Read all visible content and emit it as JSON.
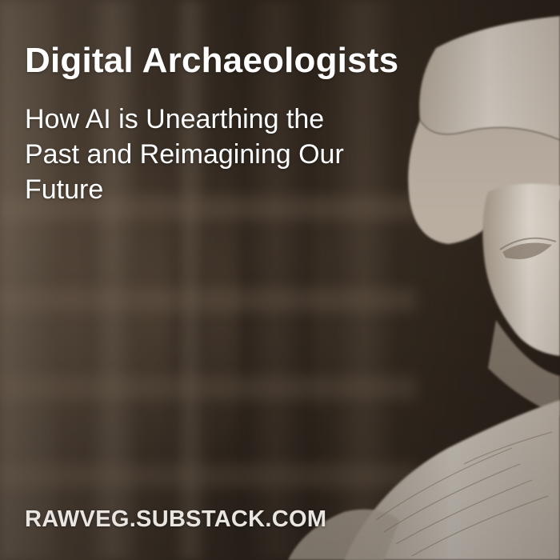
{
  "card": {
    "title": "Digital Archaeologists",
    "subtitle_lines": [
      "How AI is Unearthing the",
      "Past and Reimagining Our",
      "Future"
    ],
    "footer": "RAWVEG.SUBSTACK.COM"
  },
  "colors": {
    "text": "#ffffff",
    "footer_text": "#e9e6e2",
    "background_dark": "#2a2119",
    "stone": "#d9d2c8"
  }
}
